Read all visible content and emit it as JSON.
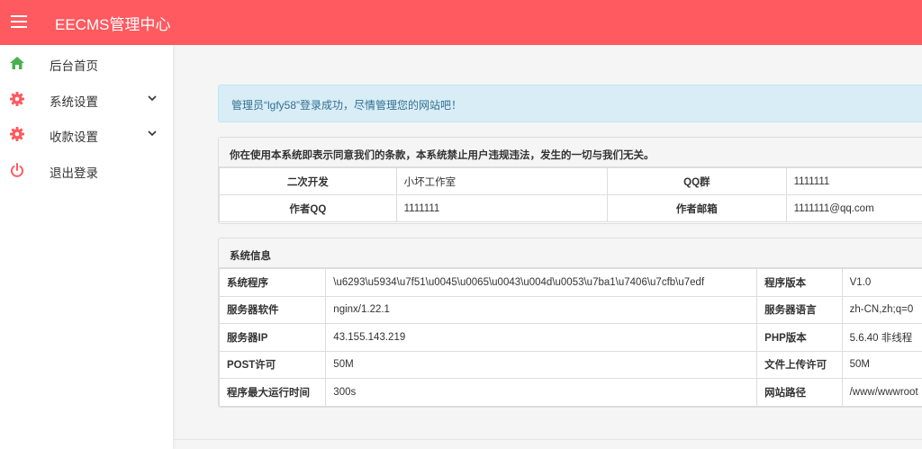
{
  "header": {
    "title": "EECMS管理中心",
    "accent_color": "#fe5a5f"
  },
  "sidebar": {
    "items": [
      {
        "label": "后台首页",
        "icon": "home-icon",
        "color": "#4caf50",
        "expandable": false
      },
      {
        "label": "系统设置",
        "icon": "gear-icon",
        "color": "#fe5a5f",
        "expandable": true
      },
      {
        "label": "收款设置",
        "icon": "gear-icon",
        "color": "#fe5a5f",
        "expandable": true
      },
      {
        "label": "退出登录",
        "icon": "power-icon",
        "color": "#fe5a5f",
        "expandable": false
      }
    ]
  },
  "alert": {
    "text": "管理员“lgfy58”登录成功，尽情管理您的网站吧！"
  },
  "notice_panel": {
    "title": "你在使用本系统即表示同意我们的条款，本系统禁止用户违规违法，发生的一切与我们无关。",
    "rows": [
      [
        "二次开发",
        "小坏工作室",
        "QQ群",
        "1111111"
      ],
      [
        "作者QQ",
        "1111111",
        "作者邮箱",
        "1111111@qq.com"
      ]
    ]
  },
  "system_panel": {
    "title": "系统信息",
    "rows": [
      [
        "系统程序",
        "\\u6293\\u5934\\u7f51\\u0045\\u0065\\u0043\\u004d\\u0053\\u7ba1\\u7406\\u7cfb\\u7edf",
        "程序版本",
        "V1.0"
      ],
      [
        "服务器软件",
        "nginx/1.22.1",
        "服务器语言",
        "zh-CN,zh;q=0"
      ],
      [
        "服务器IP",
        "43.155.143.219",
        "PHP版本",
        "5.6.40 非线程"
      ],
      [
        "POST许可",
        "50M",
        "文件上传许可",
        "50M"
      ],
      [
        "程序最大运行时间",
        "300s",
        "网站路径",
        "/www/wwwroot"
      ]
    ]
  }
}
